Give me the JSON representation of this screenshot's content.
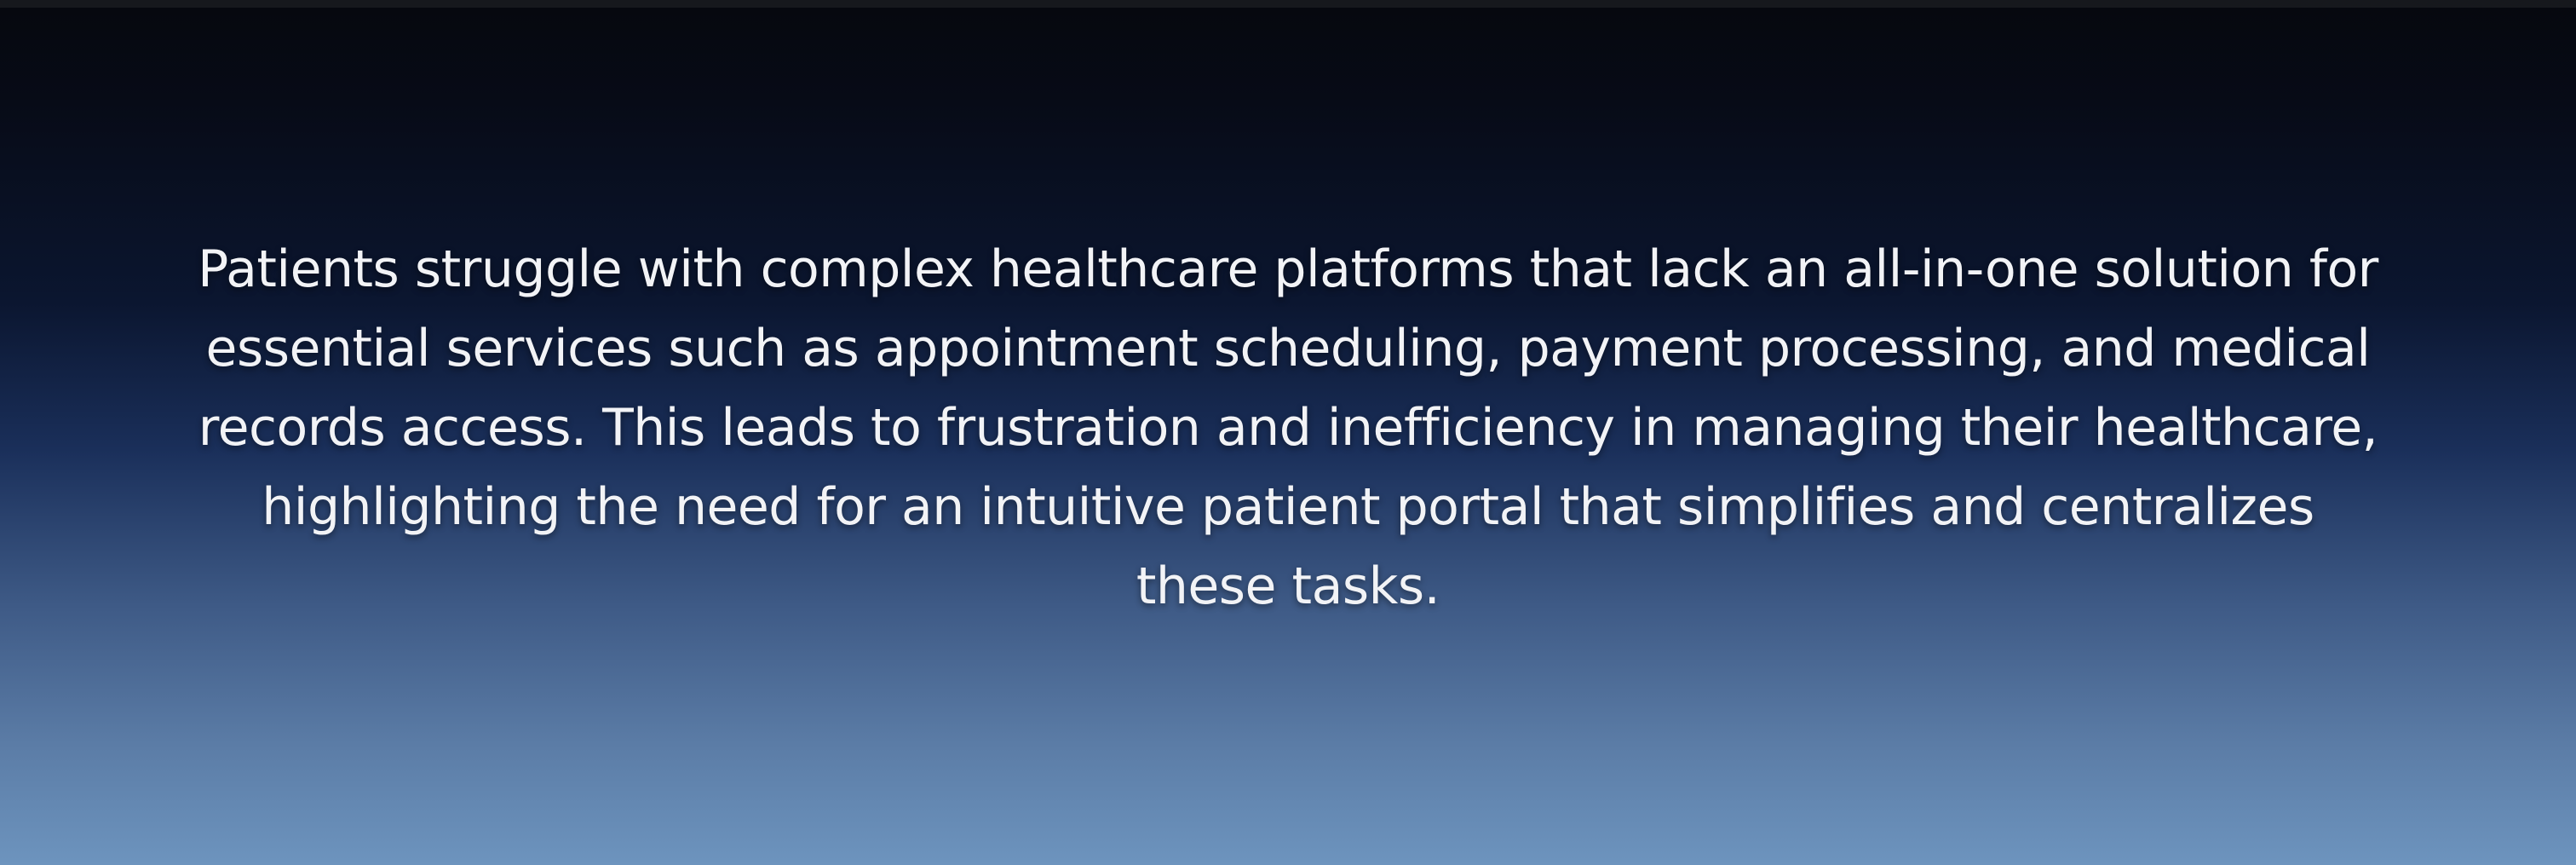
{
  "statement": {
    "text": "Patients struggle with complex healthcare platforms that lack an all-in-one solution for essential services such as appointment scheduling, payment processing, and medical records access. This leads to frustration and inefficiency in managing their healthcare, highlighting the need for an intuitive patient portal that simplifies and centralizes these tasks."
  },
  "colors": {
    "background_top": "#06080e",
    "background_bottom": "#6d94be",
    "text": "#f2f3f6"
  }
}
